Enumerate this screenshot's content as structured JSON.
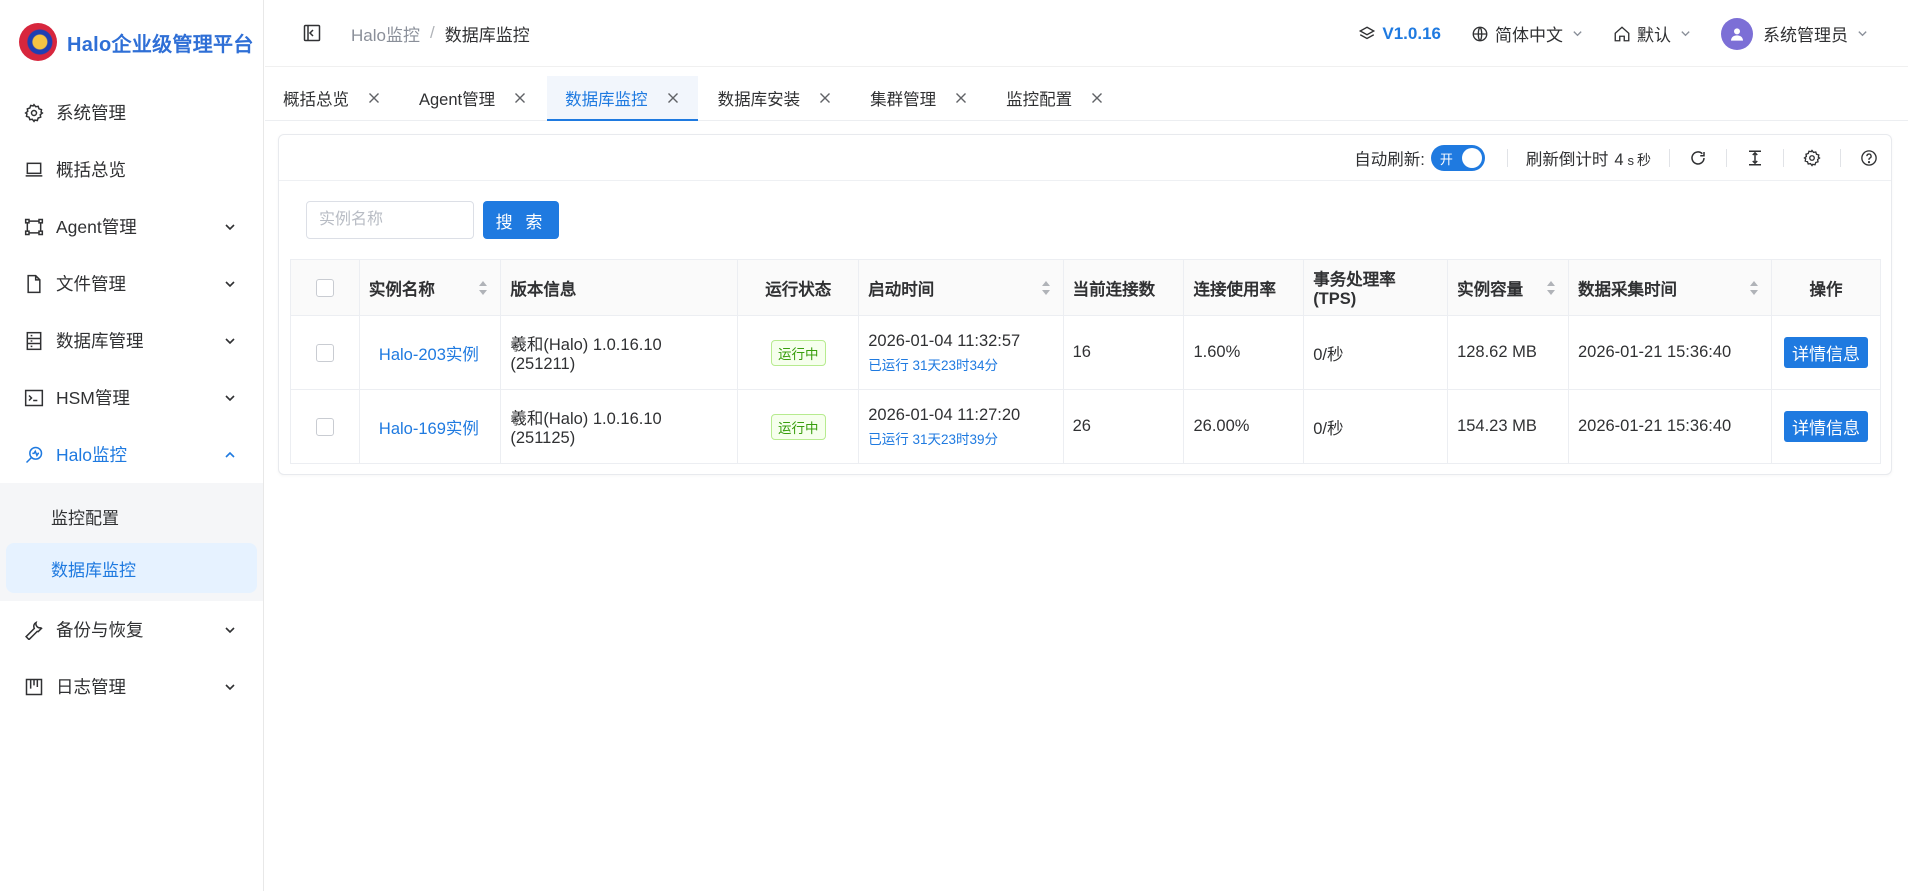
{
  "app": {
    "title": "Halo企业级管理平台"
  },
  "sidebar": {
    "items": [
      {
        "label": "系统管理",
        "icon": "gear-icon",
        "expandable": false
      },
      {
        "label": "概括总览",
        "icon": "laptop-icon",
        "expandable": false
      },
      {
        "label": "Agent管理",
        "icon": "nodes-icon",
        "expandable": true
      },
      {
        "label": "文件管理",
        "icon": "file-icon",
        "expandable": true
      },
      {
        "label": "数据库管理",
        "icon": "database-icon",
        "expandable": true
      },
      {
        "label": "HSM管理",
        "icon": "terminal-icon",
        "expandable": true
      },
      {
        "label": "Halo监控",
        "icon": "monitor-icon",
        "expandable": true,
        "expanded": true
      },
      {
        "label": "备份与恢复",
        "icon": "wrench-icon",
        "expandable": true
      },
      {
        "label": "日志管理",
        "icon": "board-icon",
        "expandable": true
      }
    ],
    "submenu": [
      {
        "label": "监控配置"
      },
      {
        "label": "数据库监控",
        "selected": true
      }
    ]
  },
  "header": {
    "breadcrumb": [
      "Halo监控",
      "数据库监控"
    ],
    "breadcrumb_sep": "/",
    "version": "V1.0.16",
    "language": "简体中文",
    "workspace": "默认",
    "user": "系统管理员"
  },
  "tabs": [
    {
      "label": "概括总览"
    },
    {
      "label": "Agent管理"
    },
    {
      "label": "数据库监控",
      "active": true
    },
    {
      "label": "数据库安装"
    },
    {
      "label": "集群管理"
    },
    {
      "label": "监控配置"
    }
  ],
  "toolbar": {
    "auto_refresh_label": "自动刷新:",
    "switch_text": "开",
    "countdown_label": "刷新倒计时",
    "countdown_value": "4",
    "countdown_unit": "s",
    "countdown_unit2": "秒"
  },
  "search": {
    "placeholder": "实例名称",
    "value": "",
    "button_label": "搜 索"
  },
  "table": {
    "columns": [
      "实例名称",
      "版本信息",
      "运行状态",
      "启动时间",
      "当前连接数",
      "连接使用率",
      "事务处理率(TPS)",
      "实例容量",
      "数据采集时间",
      "操作"
    ],
    "rows": [
      {
        "name": "Halo-203实例",
        "version": "羲和(Halo) 1.0.16.10 (251211)",
        "status": "运行中",
        "start_time": "2026-01-04 11:32:57",
        "uptime": "已运行 31天23时34分",
        "connections": "16",
        "usage": "1.60%",
        "tps": "0/秒",
        "capacity": "128.62 MB",
        "collect_time": "2026-01-21 15:36:40",
        "action": "详情信息"
      },
      {
        "name": "Halo-169实例",
        "version": "羲和(Halo) 1.0.16.10 (251125)",
        "status": "运行中",
        "start_time": "2026-01-04 11:27:20",
        "uptime": "已运行 31天23时39分",
        "connections": "26",
        "usage": "26.00%",
        "tps": "0/秒",
        "capacity": "154.23 MB",
        "collect_time": "2026-01-21 15:36:40",
        "action": "详情信息"
      }
    ]
  },
  "colors": {
    "primary": "#1f7ae0",
    "success_badge": "#389e0d",
    "avatar": "#7c6fd6"
  }
}
